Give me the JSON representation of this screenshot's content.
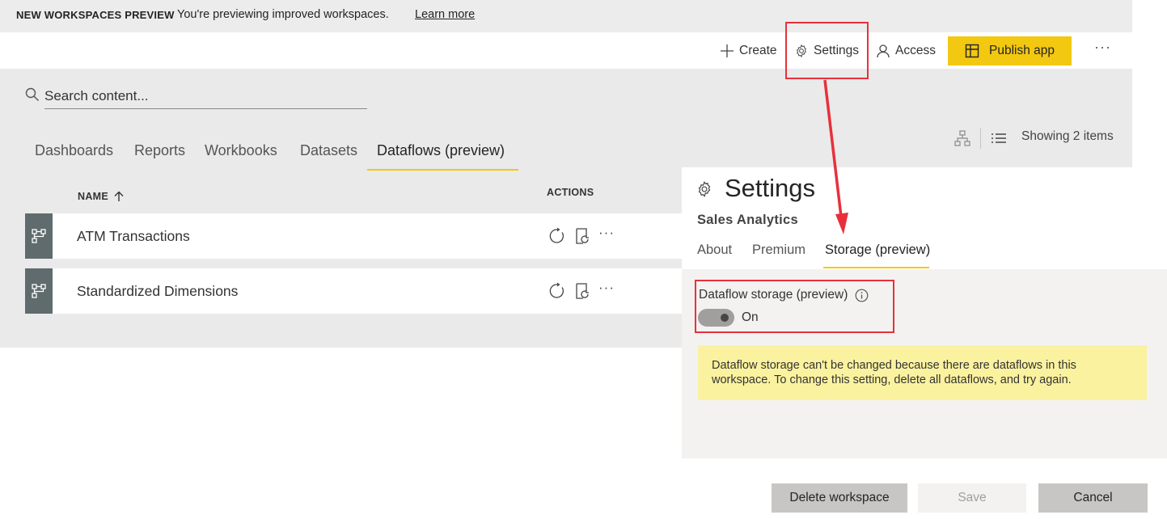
{
  "banner": {
    "title": "NEW WORKSPACES PREVIEW",
    "text": "You're previewing improved workspaces.",
    "link": "Learn more"
  },
  "toolbar": {
    "create": "Create",
    "settings": "Settings",
    "access": "Access",
    "publish": "Publish app",
    "more": "···"
  },
  "search": {
    "placeholder": "Search content..."
  },
  "tabs": [
    "Dashboards",
    "Reports",
    "Workbooks",
    "Datasets",
    "Dataflows (preview)"
  ],
  "active_tab": "Dataflows (preview)",
  "view": {
    "showing": "Showing 2 items"
  },
  "table": {
    "columns": {
      "name": "NAME",
      "actions": "ACTIONS"
    },
    "rows": [
      {
        "name": "ATM Transactions"
      },
      {
        "name": "Standardized Dimensions"
      }
    ],
    "row_more": "···"
  },
  "settings_pane": {
    "title": "Settings",
    "workspace": "Sales Analytics",
    "tabs": [
      "About",
      "Premium",
      "Storage (preview)"
    ],
    "active_tab": "Storage (preview)",
    "storage_label": "Dataflow storage (preview)",
    "toggle_state": "On",
    "notice": "Dataflow storage can't be changed because there are dataflows in this workspace. To change this setting, delete all dataflows, and try again.",
    "buttons": {
      "delete": "Delete workspace",
      "save": "Save",
      "cancel": "Cancel"
    }
  },
  "colors": {
    "accent": "#f2c811",
    "callout": "#e8303a",
    "notice": "#fbf29f",
    "row_icon": "#5f6b6d"
  },
  "icons": [
    "plus-icon",
    "gear-icon",
    "person-icon",
    "publish-app-icon",
    "search-icon",
    "lineage-view-icon",
    "list-view-icon",
    "sort-up-icon",
    "dataflow-icon",
    "refresh-icon",
    "schedule-refresh-icon",
    "info-icon"
  ]
}
